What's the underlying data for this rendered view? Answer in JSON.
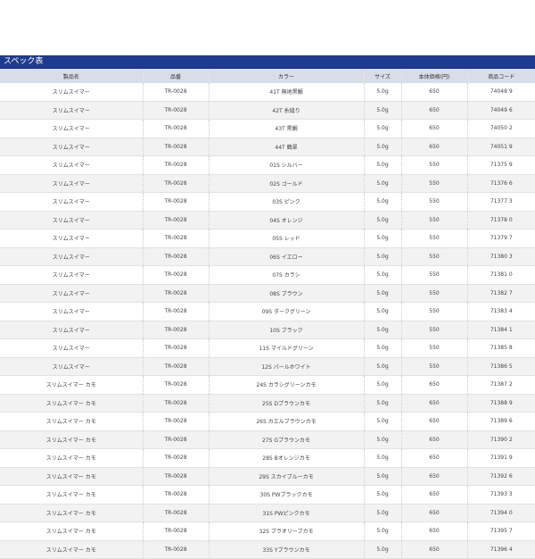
{
  "title": "スペック表",
  "headers": [
    "製品名",
    "品番",
    "カラー",
    "サイズ",
    "本体価格(円)",
    "商品コード"
  ],
  "rows": [
    [
      "スリムスイマー",
      "TR-0028",
      "41T 無地黒鯛",
      "5.0g",
      "650",
      "74048 9"
    ],
    [
      "スリムスイマー",
      "TR-0028",
      "42T 糸縫り",
      "5.0g",
      "650",
      "74049 6"
    ],
    [
      "スリムスイマー",
      "TR-0028",
      "43T 黒鯛",
      "5.0g",
      "650",
      "74050 2"
    ],
    [
      "スリムスイマー",
      "TR-0028",
      "44T 鶴翠",
      "5.0g",
      "650",
      "74051 9"
    ],
    [
      "スリムスイマー",
      "TR-0028",
      "01S シルバー",
      "5.0g",
      "550",
      "71375 9"
    ],
    [
      "スリムスイマー",
      "TR-0028",
      "02S ゴールド",
      "5.0g",
      "550",
      "71376 6"
    ],
    [
      "スリムスイマー",
      "TR-0028",
      "03S ピンク",
      "5.0g",
      "550",
      "71377 3"
    ],
    [
      "スリムスイマー",
      "TR-0028",
      "04S オレンジ",
      "5.0g",
      "550",
      "71378 0"
    ],
    [
      "スリムスイマー",
      "TR-0028",
      "05S レッド",
      "5.0g",
      "550",
      "71379 7"
    ],
    [
      "スリムスイマー",
      "TR-0028",
      "06S イエロー",
      "5.0g",
      "550",
      "71380 3"
    ],
    [
      "スリムスイマー",
      "TR-0028",
      "07S カラシ",
      "5.0g",
      "550",
      "71381 0"
    ],
    [
      "スリムスイマー",
      "TR-0028",
      "08S ブラウン",
      "5.0g",
      "550",
      "71382 7"
    ],
    [
      "スリムスイマー",
      "TR-0028",
      "09S ダークグリーン",
      "5.0g",
      "550",
      "71383 4"
    ],
    [
      "スリムスイマー",
      "TR-0028",
      "10S ブラック",
      "5.0g",
      "550",
      "71384 1"
    ],
    [
      "スリムスイマー",
      "TR-0028",
      "11S マイルドグリーン",
      "5.0g",
      "550",
      "71385 8"
    ],
    [
      "スリムスイマー",
      "TR-0028",
      "12S パールホワイト",
      "5.0g",
      "550",
      "71386 5"
    ],
    [
      "スリムスイマー カモ",
      "TR-0028",
      "24S カラシグリーンカモ",
      "5.0g",
      "650",
      "71387 2"
    ],
    [
      "スリムスイマー カモ",
      "TR-0028",
      "25S Dブラウンカモ",
      "5.0g",
      "650",
      "71388 9"
    ],
    [
      "スリムスイマー カモ",
      "TR-0028",
      "26S カエルブラウンカモ",
      "5.0g",
      "650",
      "71389 6"
    ],
    [
      "スリムスイマー カモ",
      "TR-0028",
      "27S Gブラウンカモ",
      "5.0g",
      "650",
      "71390 2"
    ],
    [
      "スリムスイマー カモ",
      "TR-0028",
      "28S Bオレンジカモ",
      "5.0g",
      "650",
      "71391 9"
    ],
    [
      "スリムスイマー カモ",
      "TR-0028",
      "29S スカイブルーカモ",
      "5.0g",
      "650",
      "71392 6"
    ],
    [
      "スリムスイマー カモ",
      "TR-0028",
      "30S PWブラックカモ",
      "5.0g",
      "650",
      "71393 3"
    ],
    [
      "スリムスイマー カモ",
      "TR-0028",
      "31S PWピンクカモ",
      "5.0g",
      "650",
      "71394 0"
    ],
    [
      "スリムスイマー カモ",
      "TR-0028",
      "32S ブラオリーブカモ",
      "5.0g",
      "650",
      "71395 7"
    ],
    [
      "スリムスイマー カモ",
      "TR-0028",
      "33S Yブラウンカモ",
      "5.0g",
      "650",
      "71396 4"
    ]
  ],
  "colors": {
    "title_bar": "#1f3b8f",
    "header_bg": "#d9dde8",
    "stripe": "#f2f2f2"
  }
}
